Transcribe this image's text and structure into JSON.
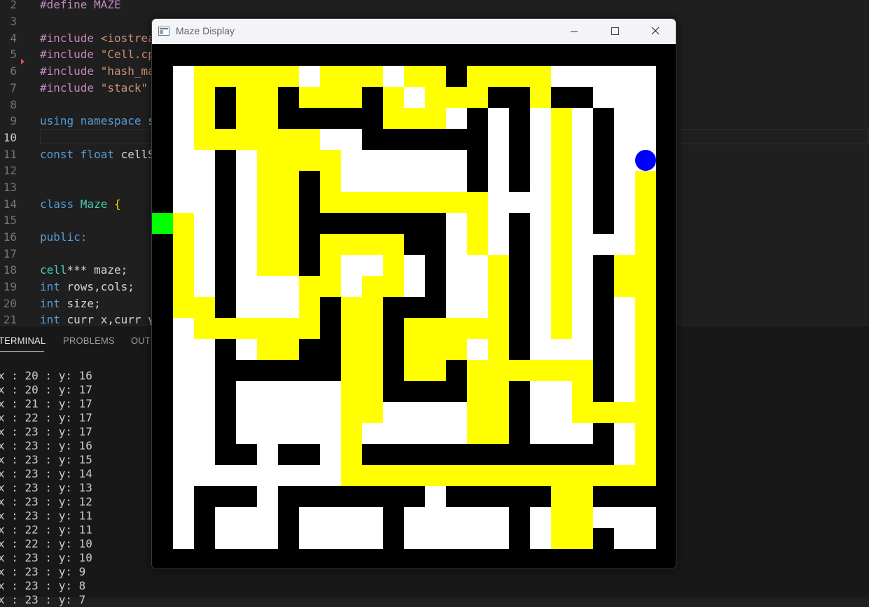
{
  "editor": {
    "lines": [
      {
        "num": "2",
        "tokens": [
          [
            "t-pre",
            "#define "
          ],
          [
            "t-macro",
            "MAZE"
          ]
        ]
      },
      {
        "num": "3",
        "tokens": []
      },
      {
        "num": "4",
        "tokens": [
          [
            "t-pre",
            "#include "
          ],
          [
            "t-str",
            "<iostrea"
          ]
        ]
      },
      {
        "num": "5",
        "tokens": [
          [
            "t-pre",
            "#include "
          ],
          [
            "t-str",
            "\"Cell.cp"
          ]
        ]
      },
      {
        "num": "6",
        "tokens": [
          [
            "t-pre",
            "#include "
          ],
          [
            "t-str",
            "\"hash_ma"
          ]
        ]
      },
      {
        "num": "7",
        "tokens": [
          [
            "t-pre",
            "#include "
          ],
          [
            "t-str",
            "\"stack\""
          ]
        ]
      },
      {
        "num": "8",
        "tokens": []
      },
      {
        "num": "9",
        "tokens": [
          [
            "t-kw",
            "using "
          ],
          [
            "t-kw",
            "namespace "
          ],
          [
            "t-type",
            "s"
          ]
        ]
      },
      {
        "num": "10",
        "tokens": []
      },
      {
        "num": "11",
        "tokens": [
          [
            "t-kw",
            "const "
          ],
          [
            "t-kw",
            "float "
          ],
          [
            "t-plain",
            "cellS"
          ]
        ]
      },
      {
        "num": "12",
        "tokens": []
      },
      {
        "num": "13",
        "tokens": []
      },
      {
        "num": "14",
        "tokens": [
          [
            "t-kw",
            "class "
          ],
          [
            "t-type",
            "Maze "
          ],
          [
            "t-brace",
            "{"
          ]
        ]
      },
      {
        "num": "15",
        "tokens": []
      },
      {
        "num": "16",
        "tokens": [
          [
            "t-kw",
            "public:"
          ]
        ]
      },
      {
        "num": "17",
        "tokens": []
      },
      {
        "num": "18",
        "tokens": [
          [
            "t-type",
            "cell"
          ],
          [
            "t-plain",
            "*** maze;"
          ]
        ]
      },
      {
        "num": "19",
        "tokens": [
          [
            "t-kw",
            "int "
          ],
          [
            "t-plain",
            "rows,cols;"
          ]
        ]
      },
      {
        "num": "20",
        "tokens": [
          [
            "t-kw",
            "int "
          ],
          [
            "t-plain",
            "size;"
          ]
        ]
      },
      {
        "num": "21",
        "tokens": [
          [
            "t-kw",
            "int "
          ],
          [
            "t-plain",
            "curr_x,curr_y"
          ]
        ]
      }
    ]
  },
  "panel": {
    "tabs": [
      "TERMINAL",
      "PROBLEMS",
      "OUT"
    ],
    "terminal_lines": [
      "x : 20 : y: 16",
      "x : 20 : y: 17",
      "x : 21 : y: 17",
      "x : 22 : y: 17",
      "x : 23 : y: 17",
      "x : 23 : y: 16",
      "x : 23 : y: 15",
      "x : 23 : y: 14",
      "x : 23 : y: 13",
      "x : 23 : y: 12",
      "x : 23 : y: 11",
      "x : 22 : y: 11",
      "x : 22 : y: 10",
      "x : 23 : y: 10",
      "x : 23 : y: 9",
      "x : 23 : y: 8",
      "x : 23 : y: 7"
    ]
  },
  "maze_window": {
    "title": "Maze Display",
    "icons": {
      "app": "window-app-icon",
      "min": "minimize-icon",
      "max": "maximize-icon",
      "close": "close-icon"
    },
    "colors": {
      "wall": "#000000",
      "open": "#ffffff",
      "path": "#ffff00",
      "start": "#00ff00",
      "player": "#0000ff"
    },
    "grid": [
      "BBBBBBBBBBBBBBBBBBBBBBBBB",
      "BWYYYYYWYYYWYYBYYYYWWWWWB",
      "BWYBYYBYYYBYWYYYBBYBBWWWB",
      "BWYBYYBBBBBYYYWBWBWYWBWWB",
      "BWYYYYYYWWBBBBBBWBWYWBWWB",
      "BWWBWYYYYWWWWWWBWBWYWBWWB",
      "BWWBWYYBYWWWWWWBWBWYWBWYB",
      "BWWBWYYBYYYYYYYYWWWYWBWYB",
      "GYWBWYYBBBBBBBWYWBWYWBWYB",
      "BYWBWYYBYYYYBBWYWBWYWWWYB",
      "BYWBWYYBYWWYWBWWYBWYWBYYB",
      "BYWBWWWYYWYYWBWWYBWYWBYYB",
      "BYYBWWWYBYYBBBWWYBWYWBWYB",
      "BWYYYYYYBYYBYYYYYBWYWBWYB",
      "BWWBWYYBBYYBYYYWYBWWWBWYB",
      "BWWBBBBBBYYBYYBYYYYYYBWYB",
      "BWWBWWWWWYYBBBBYYBWWYBWYB",
      "BWWBWWWWWYYWWWWYYBWWYYYYB",
      "BWWBWWWWWYWWWWWYYBWWWBWYB",
      "BWWBBWBBWYBBBBBBBBBBBBWYB",
      "BWWWWWWWWYYYYYYYYYYYYYYYB",
      "BWBBBWBBBBBBBWBBBBBYYBBBB",
      "BWBWWWBWWWWBWWWWWBWYYWWWB",
      "BWBWWWBWWWWBWWWWWBWYYBWWB",
      "BBBBBBBBBBBBBBBBBBBBBBBBB"
    ],
    "player": {
      "row": 5,
      "col": 23
    }
  }
}
